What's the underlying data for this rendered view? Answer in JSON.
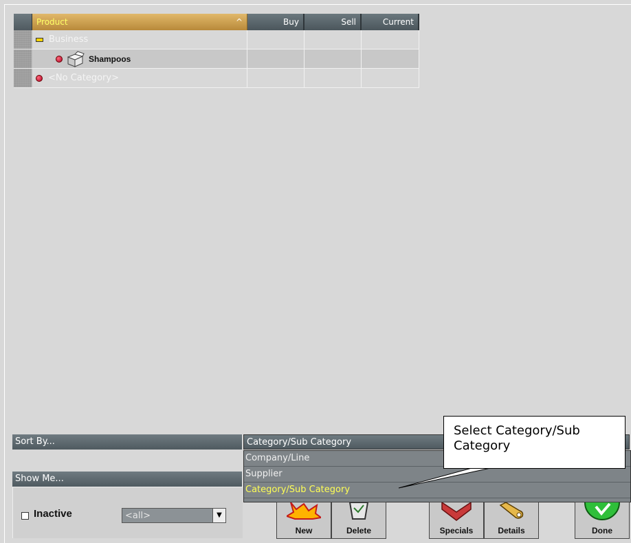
{
  "grid": {
    "columns": {
      "product": "Product",
      "buy": "Buy",
      "sell": "Sell",
      "current": "Current"
    },
    "rows": [
      {
        "name": "Business",
        "kind": "group",
        "icon": "minus-icon"
      },
      {
        "name": "Shampoos",
        "kind": "item",
        "icon": "box-icon",
        "selected": true
      },
      {
        "name": "<No Category>",
        "kind": "item",
        "icon": "bullet-icon"
      }
    ]
  },
  "sort_by": {
    "label": "Sort By...",
    "selected": "Category/Sub Category",
    "options": [
      "Company/Line",
      "Supplier",
      "Category/Sub Category"
    ]
  },
  "show_me": {
    "label": "Show Me...",
    "inactive_label": "Inactive",
    "filter_value": "<all>"
  },
  "buttons": {
    "new": "New",
    "delete": "Delete",
    "specials": "Specials",
    "details": "Details",
    "done": "Done"
  },
  "callout": {
    "text": "Select Category/Sub Category"
  },
  "colors": {
    "header_accent": "#ffff66",
    "active_option": "#ffff55"
  }
}
